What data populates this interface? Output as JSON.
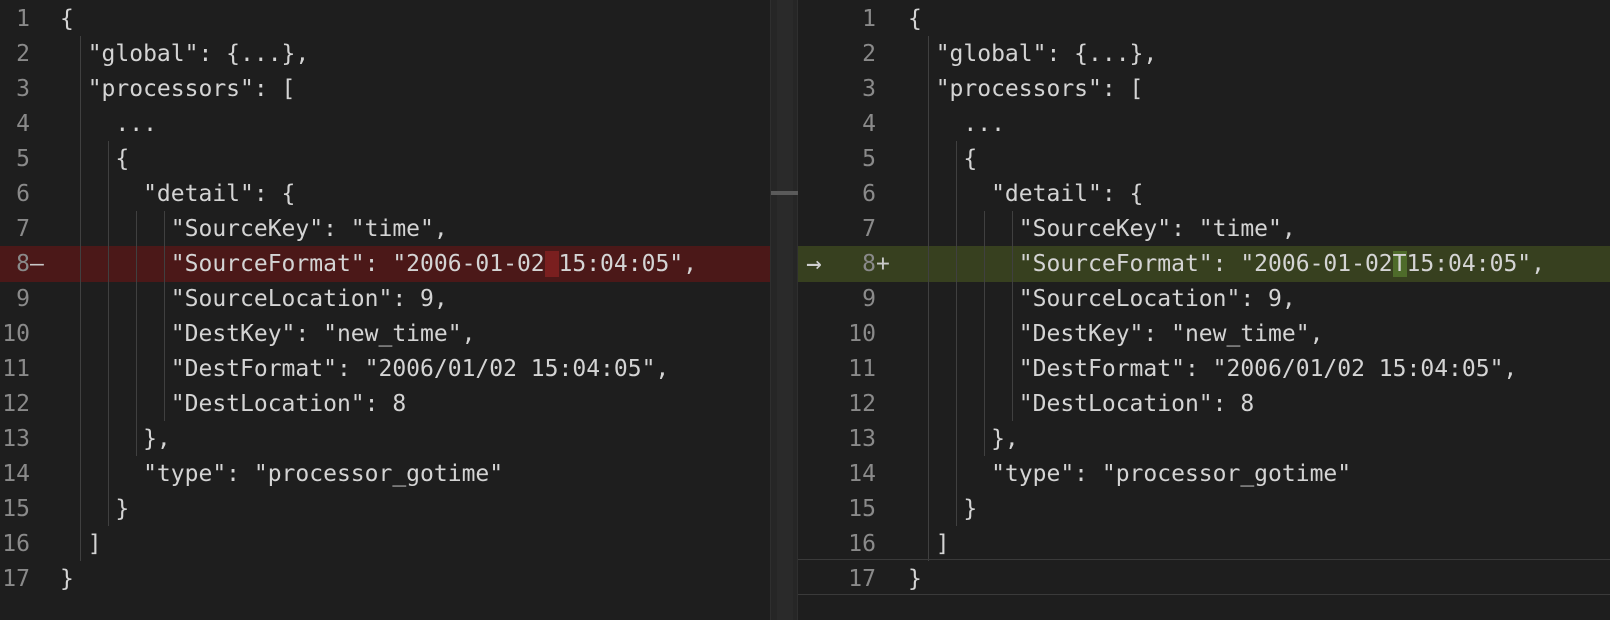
{
  "left": {
    "lines": [
      {
        "num": "1",
        "text": "{"
      },
      {
        "num": "2",
        "text": "  \"global\": {...},"
      },
      {
        "num": "3",
        "text": "  \"processors\": ["
      },
      {
        "num": "4",
        "text": "    ..."
      },
      {
        "num": "5",
        "text": "    {"
      },
      {
        "num": "6",
        "text": "      \"detail\": {"
      },
      {
        "num": "7",
        "text": "        \"SourceKey\": \"time\","
      },
      {
        "num": "8",
        "marker": "—",
        "pre": "        \"SourceFormat\": \"2006-01-02",
        "changed": " ",
        "post": "15:04:05\","
      },
      {
        "num": "9",
        "text": "        \"SourceLocation\": 9,"
      },
      {
        "num": "10",
        "text": "        \"DestKey\": \"new_time\","
      },
      {
        "num": "11",
        "text": "        \"DestFormat\": \"2006/01/02 15:04:05\","
      },
      {
        "num": "12",
        "text": "        \"DestLocation\": 8"
      },
      {
        "num": "13",
        "text": "      },"
      },
      {
        "num": "14",
        "text": "      \"type\": \"processor_gotime\""
      },
      {
        "num": "15",
        "text": "    }"
      },
      {
        "num": "16",
        "text": "  ]"
      },
      {
        "num": "17",
        "text": "}"
      }
    ]
  },
  "right": {
    "arrow": "→",
    "lines": [
      {
        "num": "1",
        "text": "{"
      },
      {
        "num": "2",
        "text": "  \"global\": {...},"
      },
      {
        "num": "3",
        "text": "  \"processors\": ["
      },
      {
        "num": "4",
        "text": "    ..."
      },
      {
        "num": "5",
        "text": "    {"
      },
      {
        "num": "6",
        "text": "      \"detail\": {"
      },
      {
        "num": "7",
        "text": "        \"SourceKey\": \"time\","
      },
      {
        "num": "8",
        "marker": "+",
        "pre": "        \"SourceFormat\": \"2006-01-02",
        "changed": "T",
        "post": "15:04:05\","
      },
      {
        "num": "9",
        "text": "        \"SourceLocation\": 9,"
      },
      {
        "num": "10",
        "text": "        \"DestKey\": \"new_time\","
      },
      {
        "num": "11",
        "text": "        \"DestFormat\": \"2006/01/02 15:04:05\","
      },
      {
        "num": "12",
        "text": "        \"DestLocation\": 8"
      },
      {
        "num": "13",
        "text": "      },"
      },
      {
        "num": "14",
        "text": "      \"type\": \"processor_gotime\""
      },
      {
        "num": "15",
        "text": "    }"
      },
      {
        "num": "16",
        "text": "  ]"
      },
      {
        "num": "17",
        "text": "}"
      }
    ]
  }
}
